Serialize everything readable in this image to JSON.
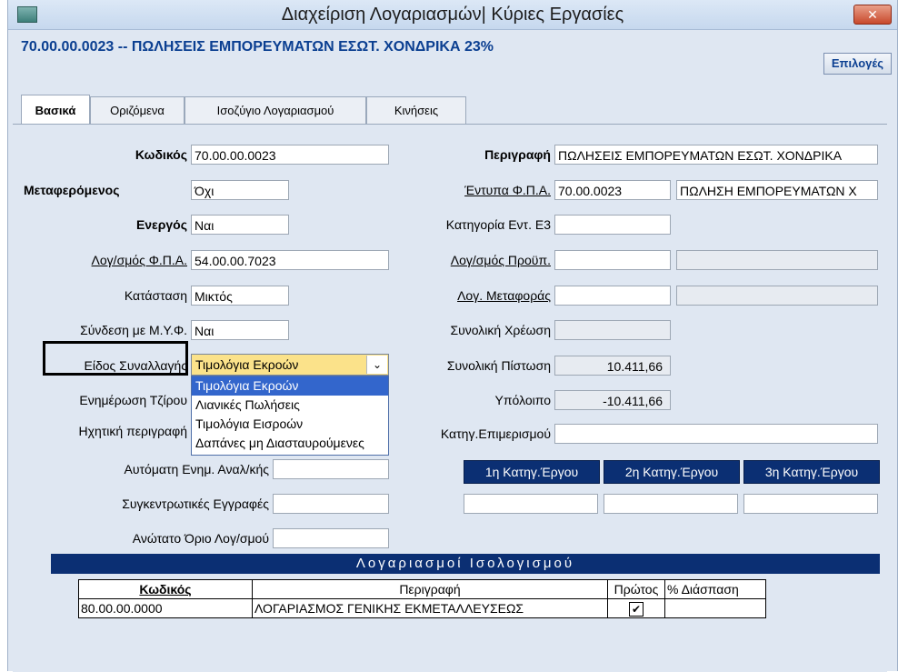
{
  "window": {
    "title": "Διαχείριση Λογαριασμών| Κύριες Εργασίες",
    "close_glyph": "✕"
  },
  "header": {
    "account_title": "70.00.00.0023 -- ΠΩΛΗΣΕΙΣ ΕΜΠΟΡΕΥΜΑΤΩΝ ΕΣΩΤ. ΧΟΝΔΡΙΚΑ 23%",
    "options_label": "Επιλογές"
  },
  "tabs": [
    {
      "label": "Βασικά"
    },
    {
      "label": "Οριζόμενα"
    },
    {
      "label": "Ισοζύγιο Λογαριασμού"
    },
    {
      "label": "Κινήσεις"
    }
  ],
  "left": {
    "code": {
      "label": "Κωδικός",
      "value": "70.00.00.0023"
    },
    "transferred": {
      "label": "Μεταφερόμενος",
      "value": "Όχι"
    },
    "active": {
      "label": "Ενεργός",
      "value": "Ναι"
    },
    "vat_account": {
      "label": "Λογ/σμός Φ.Π.Α.",
      "value": "54.00.00.7023"
    },
    "status": {
      "label": "Κατάσταση",
      "value": "Μικτός"
    },
    "myf_link": {
      "label": "Σύνδεση με Μ.Υ.Φ.",
      "value": "Ναι"
    },
    "transaction_type": {
      "label": "Είδος Συναλλαγής",
      "value": "Τιμολόγια Εκροών"
    },
    "turnover_update": {
      "label": "Ενημέρωση Τζίρου"
    },
    "audio_description": {
      "label": "Ηχητική περιγραφή"
    },
    "auto_update": {
      "label": "Αυτόματη Ενημ. Αναλ/κής",
      "value": ""
    },
    "summary_entries": {
      "label": "Συγκεντρωτικές Εγγραφές",
      "value": ""
    },
    "max_limit": {
      "label": "Ανώτατο Όριο Λογ/σμού",
      "value": ""
    }
  },
  "dropdown": {
    "options": [
      "Τιμολόγια Εκροών",
      "Λιανικές Πωλήσεις",
      "Τιμολόγια Εισροών",
      "Δαπάνες μη Διασταυρούμενες"
    ],
    "arrow_glyph": "⌄"
  },
  "right": {
    "description": {
      "label": "Περιγραφή",
      "value": "ΠΩΛΗΣΕΙΣ ΕΜΠΟΡΕΥΜΑΤΩΝ ΕΣΩΤ. ΧΟΝΔΡΙΚΑ"
    },
    "vat_forms": {
      "label": "Έντυπα Φ.Π.Α.",
      "code": "70.00.0023",
      "name": "ΠΩΛΗΣΗ ΕΜΠΟΡΕΥΜΑΤΩΝ Χ"
    },
    "e3_category": {
      "label": "Κατηγορία Εντ. Ε3",
      "value": ""
    },
    "budget_account": {
      "label": "Λογ/σμός Προϋπ.",
      "value": ""
    },
    "transfer_account": {
      "label": "Λογ. Μεταφοράς",
      "value": ""
    },
    "total_debit": {
      "label": "Συνολική Χρέωση",
      "value": ""
    },
    "total_credit": {
      "label": "Συνολική Πίστωση",
      "value": "10.411,66"
    },
    "balance": {
      "label": "Υπόλοιπο",
      "value": "-10.411,66"
    },
    "allocation_category": {
      "label": "Κατηγ.Επιμερισμού",
      "value": ""
    },
    "project_categories": [
      "1η Κατηγ.Έργου",
      "2η Κατηγ.Έργου",
      "3η Κατηγ.Έργου"
    ]
  },
  "ledger": {
    "title": "Λογαριασμοί Ισολογισμού",
    "columns": [
      "Κωδικός",
      "Περιγραφή",
      "Πρώτος",
      "% Διάσπαση"
    ],
    "rows": [
      {
        "code": "80.00.00.0000",
        "description": "ΛΟΓΑΡΙΑΣΜΟΣ ΓΕΝΙΚΗΣ ΕΚΜΕΤΑΛΛΕΥΣΕΩΣ",
        "first_mark": "✔",
        "split": ""
      }
    ]
  }
}
